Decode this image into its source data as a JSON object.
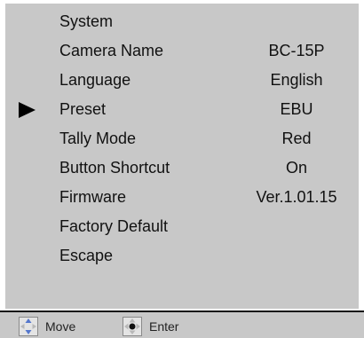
{
  "menu": {
    "selected_index": 3,
    "items": [
      {
        "label": "System",
        "value": ""
      },
      {
        "label": "Camera Name",
        "value": "BC-15P"
      },
      {
        "label": "Language",
        "value": "English"
      },
      {
        "label": "Preset",
        "value": "EBU"
      },
      {
        "label": "Tally Mode",
        "value": "Red"
      },
      {
        "label": "Button Shortcut",
        "value": "On"
      },
      {
        "label": "Firmware",
        "value": "Ver.1.01.15"
      },
      {
        "label": "Factory Default",
        "value": ""
      },
      {
        "label": "Escape",
        "value": ""
      }
    ]
  },
  "footer": {
    "move_label": "Move",
    "move_icon": "dpad-up-down-icon",
    "enter_label": "Enter",
    "enter_icon": "dpad-enter-icon"
  },
  "colors": {
    "panel_bg": "#c8c8c8",
    "text": "#111111",
    "cursor": "#000000"
  }
}
